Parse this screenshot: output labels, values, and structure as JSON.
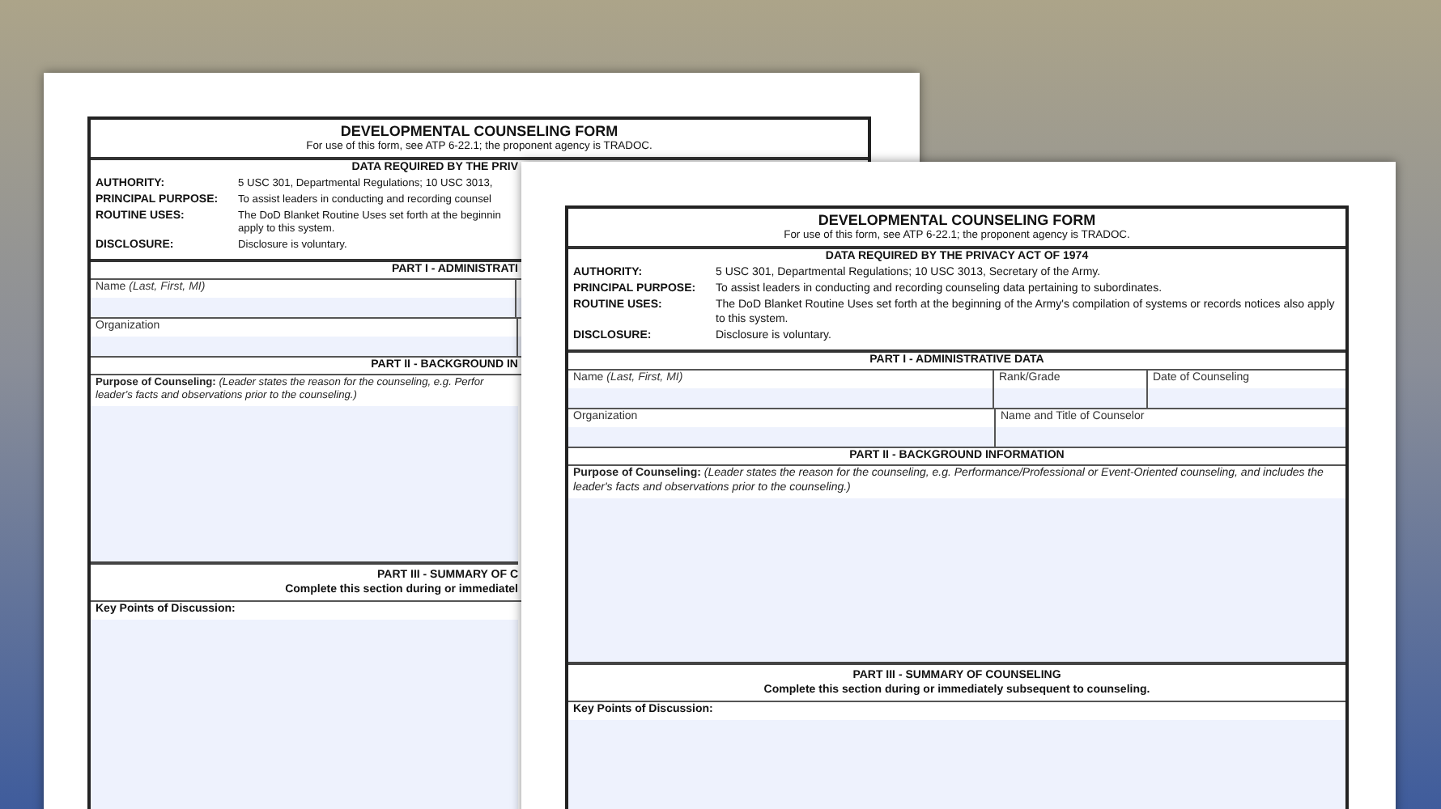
{
  "back_page": {
    "title": "DEVELOPMENTAL COUNSELING FORM",
    "subtitle": "For use of this form, see ATP 6-22.1; the proponent agency is TRADOC.",
    "privacy_heading": "DATA REQUIRED BY THE PRIV",
    "privacy_rows": [
      {
        "label": "AUTHORITY:",
        "lines": [
          "5 USC 301, Departmental Regulations; 10 USC 3013,"
        ]
      },
      {
        "label": "PRINCIPAL PURPOSE:",
        "lines": [
          "To assist leaders in conducting and recording counsel"
        ]
      },
      {
        "label": "ROUTINE USES:",
        "lines": [
          "The DoD Blanket Routine Uses set forth at the beginnin",
          "apply to this system."
        ]
      },
      {
        "label": "DISCLOSURE:",
        "lines": [
          "Disclosure is voluntary."
        ]
      }
    ],
    "part_1_heading": "PART I - ADMINISTRATI",
    "field_rows": [
      [
        {
          "label": "Name *(Last, First, MI)*"
        }
      ],
      [
        {
          "label": "Organization"
        }
      ]
    ],
    "part_2_heading": "PART II - BACKGROUND IN",
    "purpose_lines": [
      "**Purpose of Counseling:** *(Leader states the reason for the counseling, e.g. Perfor*",
      "*leader's facts and observations prior to the counseling.)*"
    ],
    "part_3_heading": "PART III - SUMMARY OF C",
    "part_3_note": "Complete this section during or immediatel",
    "key_points_label": "Key Points of Discussion:"
  },
  "front_page": {
    "title": "DEVELOPMENTAL COUNSELING FORM",
    "subtitle": "For use of this form, see ATP 6-22.1; the proponent agency is TRADOC.",
    "privacy_heading": "DATA REQUIRED BY THE PRIVACY ACT OF 1974",
    "privacy_rows": [
      {
        "label": "AUTHORITY:",
        "lines": [
          "5 USC 301, Departmental Regulations; 10 USC 3013, Secretary of the Army."
        ]
      },
      {
        "label": "PRINCIPAL PURPOSE:",
        "lines": [
          "To assist leaders in conducting and recording counseling data pertaining to subordinates."
        ]
      },
      {
        "label": "ROUTINE USES:",
        "lines": [
          "The DoD Blanket Routine Uses set forth at the beginning of the Army's compilation of systems or records notices also apply to this system."
        ]
      },
      {
        "label": "DISCLOSURE:",
        "lines": [
          "Disclosure is voluntary."
        ]
      }
    ],
    "part_1_heading": "PART I - ADMINISTRATIVE DATA",
    "field_rows": [
      [
        {
          "label": "Name *(Last, First, MI)*"
        },
        {
          "label": "Rank/Grade"
        },
        {
          "label": "Date of Counseling"
        }
      ],
      [
        {
          "label": "Organization"
        },
        {
          "label": "Name and Title of Counselor"
        }
      ]
    ],
    "part_2_heading": "PART II - BACKGROUND INFORMATION",
    "purpose_lines": [
      "**Purpose of Counseling:** *(Leader states the reason for the counseling, e.g. Performance/Professional or Event-Oriented counseling, and includes the leader's facts and observations prior to the counseling.)*"
    ],
    "part_3_heading": "PART III - SUMMARY OF COUNSELING",
    "part_3_note": "Complete this section during or immediately subsequent to counseling.",
    "key_points_label": "Key Points of Discussion:"
  }
}
